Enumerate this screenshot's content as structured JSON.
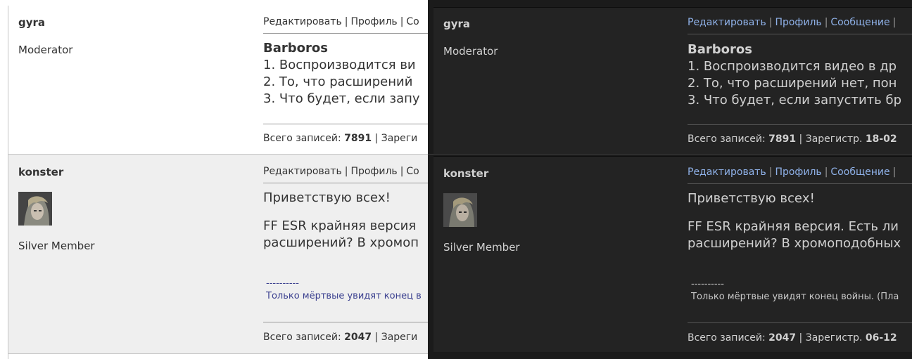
{
  "light": {
    "posts": [
      {
        "author": "gyra",
        "role": "Moderator",
        "actions": [
          "Редактировать",
          "Профиль",
          "Со"
        ],
        "title": "Barboros",
        "lines": [
          "1. Воспроизводится ви",
          "2. То, что расширений",
          "3. Что будет, если запу"
        ],
        "stats": {
          "posts_label": "Всего записей:",
          "posts_value": "7891",
          "reg_label": "Зареги"
        }
      },
      {
        "author": "konster",
        "role": "Silver Member",
        "actions": [
          "Редактировать",
          "Профиль",
          "Со"
        ],
        "lines": [
          "Приветствую всех!",
          "",
          "FF ESR крайняя версия",
          "расширений? В хромоп"
        ],
        "sig_dash": "----------",
        "sig_text": "Только мёртвые увидят конец в",
        "stats": {
          "posts_label": "Всего записей:",
          "posts_value": "2047",
          "reg_label": "Зареги"
        }
      }
    ]
  },
  "dark": {
    "posts": [
      {
        "author": "gyra",
        "role": "Moderator",
        "actions": [
          "Редактировать",
          "Профиль",
          "Сообщение"
        ],
        "title": "Barboros",
        "lines": [
          "1. Воспроизводится видео в др",
          "2. То, что расширений нет, пон",
          "3. Что будет, если запустить бр"
        ],
        "stats": {
          "posts_label": "Всего записей:",
          "posts_value": "7891",
          "reg_label": "Зарегистр.",
          "reg_value": "18-02"
        }
      },
      {
        "author": "konster",
        "role": "Silver Member",
        "actions": [
          "Редактировать",
          "Профиль",
          "Сообщение"
        ],
        "lines": [
          "Приветствую всех!",
          "",
          "FF ESR крайняя версия. Есть ли",
          "расширений? В хромоподобных"
        ],
        "sig_dash": "----------",
        "sig_text": "Только мёртвые увидят конец войны. (Пла",
        "stats": {
          "posts_label": "Всего записей:",
          "posts_value": "2047",
          "reg_label": "Зарегистр.",
          "reg_value": "06-12"
        }
      }
    ]
  }
}
